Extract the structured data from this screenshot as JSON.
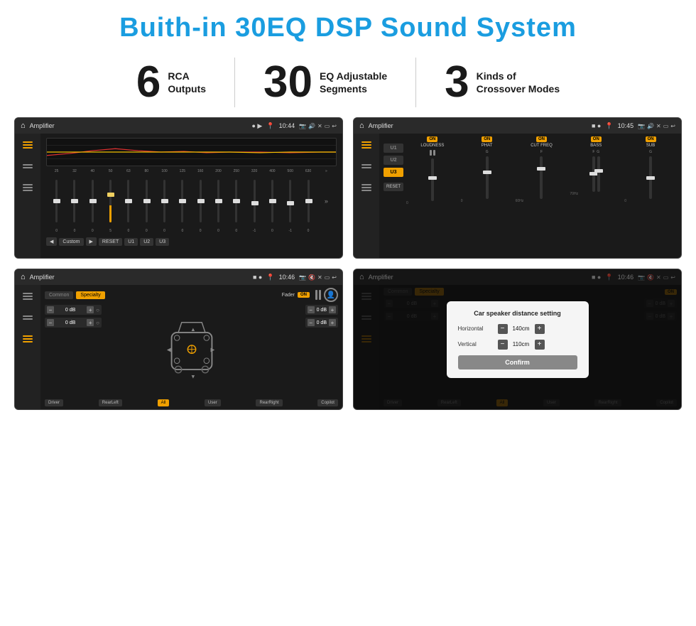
{
  "title": "Buith-in 30EQ DSP Sound System",
  "stats": [
    {
      "number": "6",
      "label": "RCA\nOutputs"
    },
    {
      "number": "30",
      "label": "EQ Adjustable\nSegments"
    },
    {
      "number": "3",
      "label": "Kinds of\nCrossover Modes"
    }
  ],
  "screens": {
    "eq": {
      "time": "10:44",
      "title": "Amplifier",
      "freq_labels": [
        "25",
        "32",
        "40",
        "50",
        "63",
        "80",
        "100",
        "125",
        "160",
        "200",
        "250",
        "320",
        "400",
        "500",
        "630"
      ],
      "slider_values": [
        "0",
        "0",
        "0",
        "5",
        "0",
        "0",
        "0",
        "0",
        "0",
        "0",
        "0",
        "-1",
        "0",
        "-1"
      ],
      "bottom_buttons": [
        "◀",
        "Custom",
        "▶",
        "RESET",
        "U1",
        "U2",
        "U3"
      ]
    },
    "dsp": {
      "time": "10:45",
      "title": "Amplifier",
      "presets": [
        "U1",
        "U2",
        "U3"
      ],
      "controls": [
        "LOUDNESS",
        "PHAT",
        "CUT FREQ",
        "BASS",
        "SUB"
      ]
    },
    "fader": {
      "time": "10:46",
      "title": "Amplifier",
      "tabs": [
        "Common",
        "Specialty"
      ],
      "fader_label": "Fader",
      "on_label": "ON",
      "volumes": [
        "0 dB",
        "0 dB",
        "0 dB",
        "0 dB"
      ],
      "bottom_buttons": [
        "Driver",
        "RearLeft",
        "All",
        "User",
        "RearRight",
        "Copilot"
      ]
    },
    "distance": {
      "time": "10:46",
      "title": "Amplifier",
      "dialog": {
        "title": "Car speaker distance setting",
        "horizontal_label": "Horizontal",
        "horizontal_value": "140cm",
        "vertical_label": "Vertical",
        "vertical_value": "110cm",
        "confirm_label": "Confirm"
      }
    }
  }
}
